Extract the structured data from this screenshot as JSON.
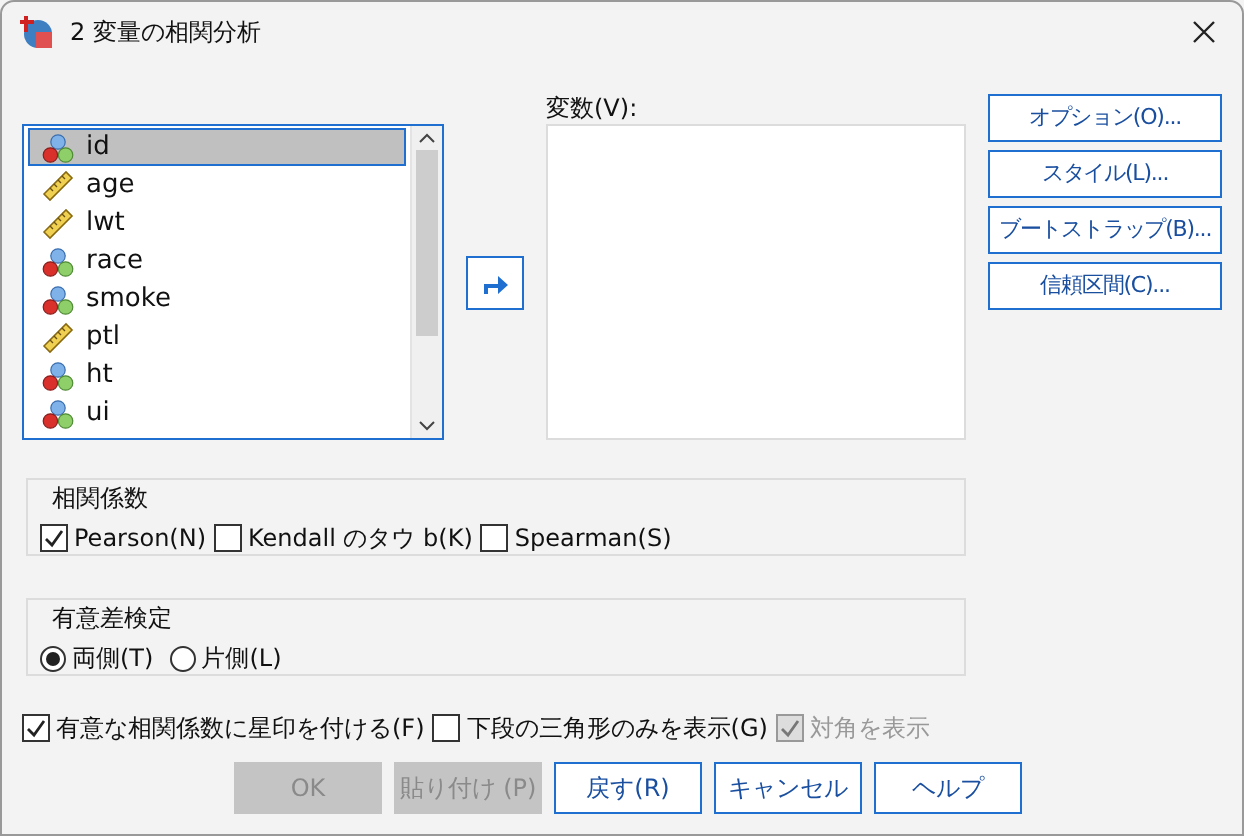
{
  "window": {
    "title": "2 変量の相関分析"
  },
  "source_list": {
    "items": [
      {
        "name": "id",
        "kind": "nominal",
        "selected": true
      },
      {
        "name": "age",
        "kind": "scale",
        "selected": false
      },
      {
        "name": "lwt",
        "kind": "scale",
        "selected": false
      },
      {
        "name": "race",
        "kind": "nominal",
        "selected": false
      },
      {
        "name": "smoke",
        "kind": "nominal",
        "selected": false
      },
      {
        "name": "ptl",
        "kind": "scale",
        "selected": false
      },
      {
        "name": "ht",
        "kind": "nominal",
        "selected": false
      },
      {
        "name": "ui",
        "kind": "nominal",
        "selected": false
      }
    ]
  },
  "target": {
    "label": "変数(V):"
  },
  "side_buttons": [
    "オプション(O)...",
    "スタイル(L)...",
    "ブートストラップ(B)...",
    "信頼区間(C)..."
  ],
  "correlation": {
    "title": "相関係数",
    "options": [
      {
        "label": "Pearson(N)",
        "checked": true
      },
      {
        "label": "Kendall のタウ b(K)",
        "checked": false
      },
      {
        "label": "Spearman(S)",
        "checked": false
      }
    ]
  },
  "test": {
    "title": "有意差検定",
    "options": [
      {
        "label": "両側(T)",
        "selected": true
      },
      {
        "label": "片側(L)",
        "selected": false
      }
    ]
  },
  "flags": [
    {
      "label": "有意な相関係数に星印を付ける(F)",
      "checked": true,
      "disabled": false
    },
    {
      "label": "下段の三角形のみを表示(G)",
      "checked": false,
      "disabled": false
    },
    {
      "label": "対角を表示",
      "checked": true,
      "disabled": true
    }
  ],
  "buttons": [
    {
      "label": "OK",
      "disabled": true
    },
    {
      "label": "貼り付け (P)",
      "disabled": true
    },
    {
      "label": "戻す(R)",
      "disabled": false
    },
    {
      "label": "キャンセル",
      "disabled": false
    },
    {
      "label": "ヘルプ",
      "disabled": false
    }
  ]
}
